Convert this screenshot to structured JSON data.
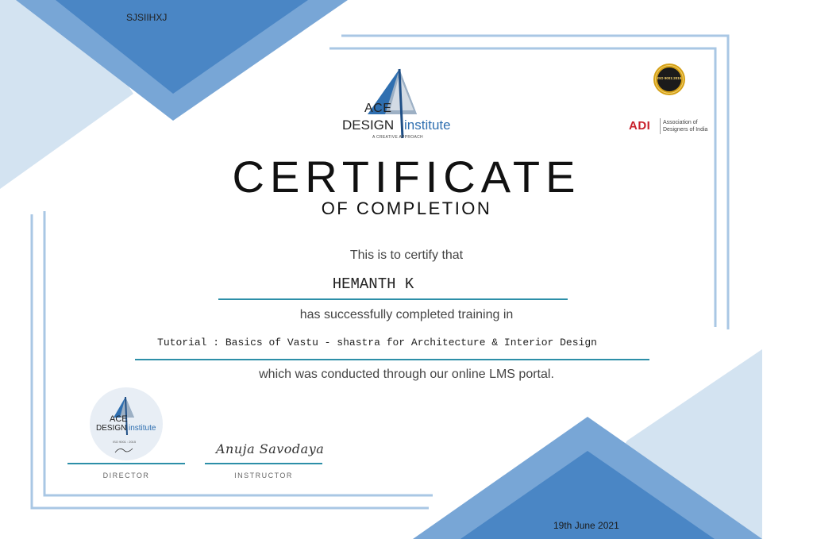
{
  "certificate_code": "SJSIIHXJ",
  "logo": {
    "line1": "ACE",
    "line2a": "DESIGN",
    "line2b": "institute",
    "tagline": "A CREATIVE APPROACH"
  },
  "iso_badge": {
    "text": "ISO 9001:2015"
  },
  "adi": {
    "mark": "ADI",
    "name_line1": "Association of",
    "name_line2": "Designers of India"
  },
  "title": "CERTIFICATE",
  "subtitle": "OF COMPLETION",
  "certify_text": "This is to certify that",
  "recipient_name": "HEMANTH K",
  "completed_text": "has successfully completed training in",
  "course_name": "Tutorial : Basics of Vastu - shastra for Architecture & Interior Design",
  "conducted_text": "which was conducted through our online LMS portal.",
  "seal": {
    "line1": "ACE",
    "line2a": "DESIGN",
    "line2b": "institute",
    "iso": "ISO 9001 : 2015"
  },
  "signatures": {
    "director_label": "DIRECTOR",
    "instructor_label": "INSTRUCTOR",
    "instructor_signature": "Anuja Savodaya"
  },
  "date": "19th June 2021",
  "colors": {
    "accent_blue": "#4a86c5",
    "light_blue": "#cfe0ef",
    "line_teal": "#2d8fa8",
    "adi_red": "#c8202b",
    "gold": "#d4a017"
  }
}
